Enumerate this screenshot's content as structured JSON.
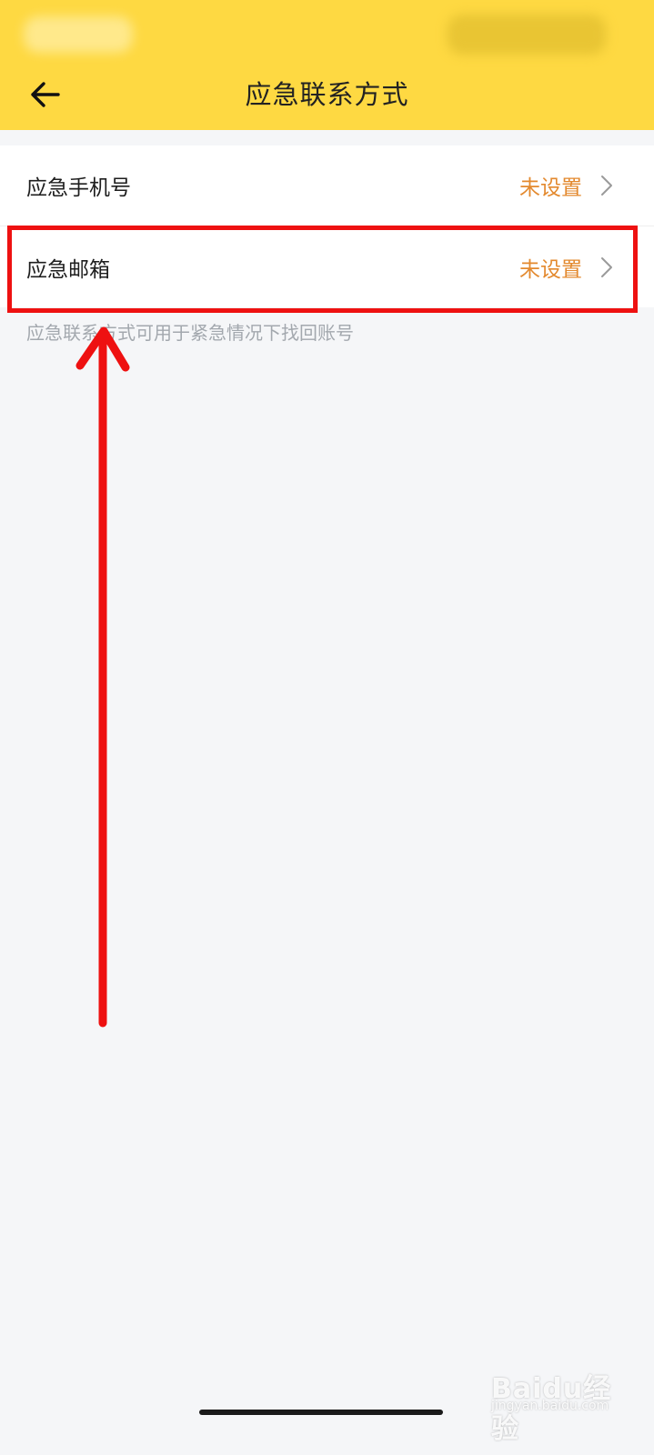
{
  "header": {
    "title": "应急联系方式",
    "back_icon": "back-arrow-icon"
  },
  "settings": {
    "items": [
      {
        "label": "应急手机号",
        "value": "未设置"
      },
      {
        "label": "应急邮箱",
        "value": "未设置"
      }
    ],
    "hint": "应急联系方式可用于紧急情况下找回账号"
  },
  "colors": {
    "header_bg": "#FED942",
    "value_text": "#E3892E",
    "annotation": "#EE1111",
    "page_bg": "#F5F6F8"
  },
  "watermark": {
    "text": "Baidu经验",
    "url": "jingyan.baidu.com"
  }
}
